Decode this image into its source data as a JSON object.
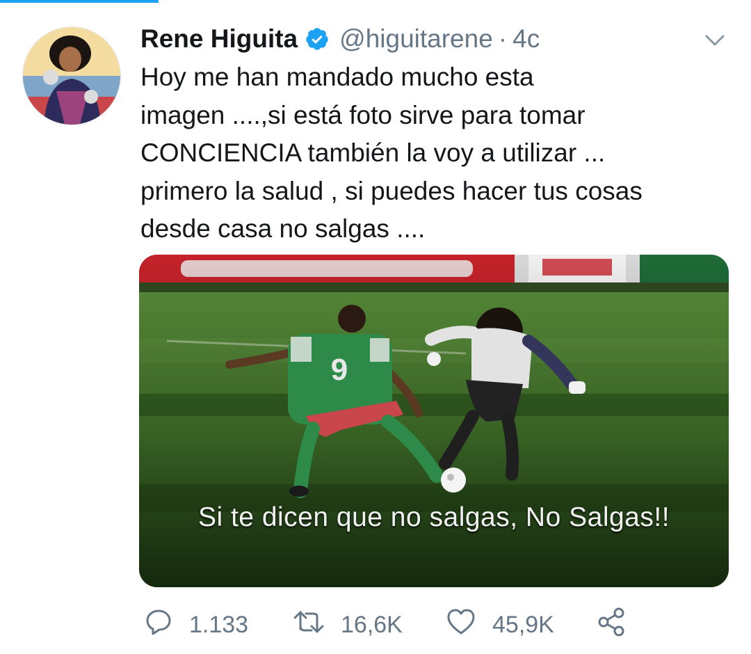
{
  "tweet": {
    "author_name": "Rene Higuita",
    "handle": "@higuitarene",
    "separator": "·",
    "time": "4c",
    "text_lines": [
      "Hoy me han mandado mucho esta",
      "imagen ....,si está foto sirve para tomar",
      "CONCIENCIA también la voy a utilizar ...",
      "primero la salud , si puedes hacer tus cosas",
      "desde casa no salgas ...."
    ],
    "image_caption": "Si te dicen que no salgas, No Salgas!!",
    "jersey_number": "9"
  },
  "actions": {
    "replies": "1.133",
    "retweets": "16,6K",
    "likes": "45,9K"
  },
  "icons": {
    "verified": "verified-badge-icon",
    "menu": "chevron-down-icon",
    "reply": "reply-icon",
    "retweet": "retweet-icon",
    "like": "heart-icon",
    "share": "share-icon"
  },
  "colors": {
    "accent": "#1da1f2",
    "text": "#14171a",
    "muted": "#657786"
  }
}
